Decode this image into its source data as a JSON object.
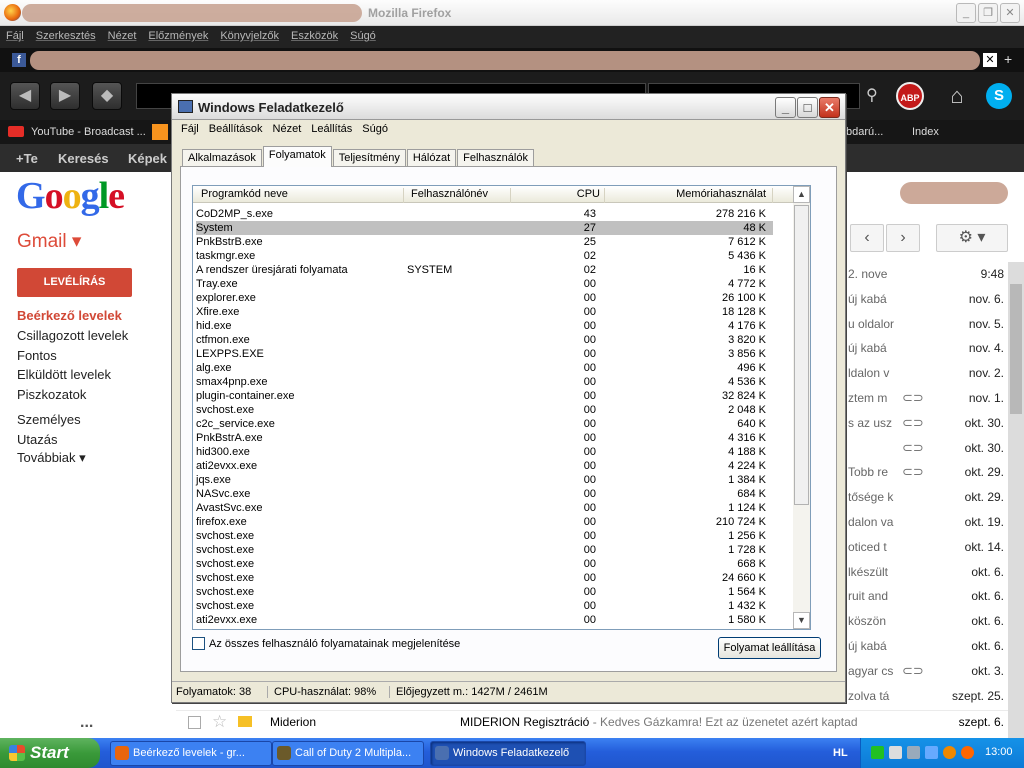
{
  "firefox": {
    "app_title": "Mozilla Firefox",
    "menu": [
      "Fájl",
      "Szerkesztés",
      "Nézet",
      "Előzmények",
      "Könyvjelzők",
      "Eszközök",
      "Súgó"
    ],
    "bookmark_youtube": "YouTube - Broadcast ...",
    "bookmark_right1": "bdarú...",
    "bookmark_right2": "Index"
  },
  "gbar": {
    "plus": "+Te",
    "search": "Keresés",
    "images": "Képek"
  },
  "gmail": {
    "logo": "Google",
    "label": "Gmail ▾",
    "compose": "LEVÉLÍRÁS",
    "nav": [
      "Beérkező levelek",
      "Csillagozott levelek",
      "Fontos",
      "Elküldött levelek",
      "Piszkozatok",
      "Személyes",
      "Utazás",
      "Továbbiak ▾"
    ],
    "more_dots": "...",
    "mail_rows": [
      {
        "preview": "2. nove",
        "clip": false,
        "date": "9:48"
      },
      {
        "preview": "új kabá",
        "clip": false,
        "date": "nov. 6."
      },
      {
        "preview": "u oldalor",
        "clip": false,
        "date": "nov. 5."
      },
      {
        "preview": "új kabá",
        "clip": false,
        "date": "nov. 4."
      },
      {
        "preview": "ldalon v",
        "clip": false,
        "date": "nov. 2."
      },
      {
        "preview": "ztem m",
        "clip": true,
        "date": "nov. 1."
      },
      {
        "preview": "s az usz",
        "clip": true,
        "date": "okt. 30."
      },
      {
        "preview": "",
        "clip": true,
        "date": "okt. 30."
      },
      {
        "preview": "Tobb re",
        "clip": true,
        "date": "okt. 29."
      },
      {
        "preview": "tősége k",
        "clip": false,
        "date": "okt. 29."
      },
      {
        "preview": "dalon va",
        "clip": false,
        "date": "okt. 19."
      },
      {
        "preview": "oticed t",
        "clip": false,
        "date": "okt. 14."
      },
      {
        "preview": "lkészült",
        "clip": false,
        "date": "okt. 6."
      },
      {
        "preview": "ruit and",
        "clip": false,
        "date": "okt. 6."
      },
      {
        "preview": "köszön",
        "clip": false,
        "date": "okt. 6."
      },
      {
        "preview": "új kabá",
        "clip": false,
        "date": "okt. 6."
      },
      {
        "preview": "agyar cs",
        "clip": true,
        "date": "okt. 3."
      },
      {
        "preview": "zolva tá",
        "clip": false,
        "date": "szept. 25."
      }
    ],
    "bottom_row": {
      "sender": "Miderion",
      "subject": "MIDERION Regisztráció",
      "snippet": " - Kedves Gázkamra! Ezt az üzenetet azért kaptad",
      "date": "szept. 6."
    }
  },
  "taskmgr": {
    "title": "Windows Feladatkezelő",
    "menu": [
      "Fájl",
      "Beállítások",
      "Nézet",
      "Leállítás",
      "Súgó"
    ],
    "tabs": [
      "Alkalmazások",
      "Folyamatok",
      "Teljesítmény",
      "Hálózat",
      "Felhasználók"
    ],
    "active_tab": "Folyamatok",
    "columns": {
      "name": "Programkód neve",
      "user": "Felhasználónév",
      "cpu": "CPU",
      "mem": "Memóriahasználat"
    },
    "processes": [
      {
        "name": "CoD2MP_s.exe",
        "user": "",
        "cpu": "43",
        "mem": "278 216 K"
      },
      {
        "name": "System",
        "user": "",
        "cpu": "27",
        "mem": "48 K",
        "selected": true
      },
      {
        "name": "PnkBstrB.exe",
        "user": "",
        "cpu": "25",
        "mem": "7 612 K"
      },
      {
        "name": "taskmgr.exe",
        "user": "",
        "cpu": "02",
        "mem": "5 436 K"
      },
      {
        "name": "A rendszer üresjárati folyamata",
        "user": "SYSTEM",
        "cpu": "02",
        "mem": "16 K"
      },
      {
        "name": "Tray.exe",
        "user": "",
        "cpu": "00",
        "mem": "4 772 K"
      },
      {
        "name": "explorer.exe",
        "user": "",
        "cpu": "00",
        "mem": "26 100 K"
      },
      {
        "name": "Xfire.exe",
        "user": "",
        "cpu": "00",
        "mem": "18 128 K"
      },
      {
        "name": "hid.exe",
        "user": "",
        "cpu": "00",
        "mem": "4 176 K"
      },
      {
        "name": "ctfmon.exe",
        "user": "",
        "cpu": "00",
        "mem": "3 820 K"
      },
      {
        "name": "LEXPPS.EXE",
        "user": "",
        "cpu": "00",
        "mem": "3 856 K"
      },
      {
        "name": "alg.exe",
        "user": "",
        "cpu": "00",
        "mem": "496 K"
      },
      {
        "name": "smax4pnp.exe",
        "user": "",
        "cpu": "00",
        "mem": "4 536 K"
      },
      {
        "name": "plugin-container.exe",
        "user": "",
        "cpu": "00",
        "mem": "32 824 K"
      },
      {
        "name": "svchost.exe",
        "user": "",
        "cpu": "00",
        "mem": "2 048 K"
      },
      {
        "name": "c2c_service.exe",
        "user": "",
        "cpu": "00",
        "mem": "640 K"
      },
      {
        "name": "PnkBstrA.exe",
        "user": "",
        "cpu": "00",
        "mem": "4 316 K"
      },
      {
        "name": "hid300.exe",
        "user": "",
        "cpu": "00",
        "mem": "4 188 K"
      },
      {
        "name": "ati2evxx.exe",
        "user": "",
        "cpu": "00",
        "mem": "4 224 K"
      },
      {
        "name": "jqs.exe",
        "user": "",
        "cpu": "00",
        "mem": "1 384 K"
      },
      {
        "name": "NASvc.exe",
        "user": "",
        "cpu": "00",
        "mem": "684 K"
      },
      {
        "name": "AvastSvc.exe",
        "user": "",
        "cpu": "00",
        "mem": "1 124 K"
      },
      {
        "name": "firefox.exe",
        "user": "",
        "cpu": "00",
        "mem": "210 724 K"
      },
      {
        "name": "svchost.exe",
        "user": "",
        "cpu": "00",
        "mem": "1 256 K"
      },
      {
        "name": "svchost.exe",
        "user": "",
        "cpu": "00",
        "mem": "1 728 K"
      },
      {
        "name": "svchost.exe",
        "user": "",
        "cpu": "00",
        "mem": "668 K"
      },
      {
        "name": "svchost.exe",
        "user": "",
        "cpu": "00",
        "mem": "24 660 K"
      },
      {
        "name": "svchost.exe",
        "user": "",
        "cpu": "00",
        "mem": "1 564 K"
      },
      {
        "name": "svchost.exe",
        "user": "",
        "cpu": "00",
        "mem": "1 432 K"
      },
      {
        "name": "ati2evxx.exe",
        "user": "",
        "cpu": "00",
        "mem": "1 580 K"
      }
    ],
    "show_all_label": "Az összes felhasználó folyamatainak megjelenítése",
    "end_process": "Folyamat leállítása",
    "status": {
      "processes": "Folyamatok: 38",
      "cpu": "CPU-használat: 98%",
      "commit": "Előjegyzett m.: 1427M / 2461M"
    }
  },
  "taskbar": {
    "start": "Start",
    "items": [
      {
        "label": "Beérkező levelek - gr...",
        "icon_color": "#e8650c"
      },
      {
        "label": "Call of Duty 2 Multipla...",
        "icon_color": "#6b5a2a"
      },
      {
        "label": "Windows Feladatkezelő",
        "icon_color": "#4a6fb0",
        "active": true
      }
    ],
    "lang": "HL",
    "clock": "13:00"
  }
}
